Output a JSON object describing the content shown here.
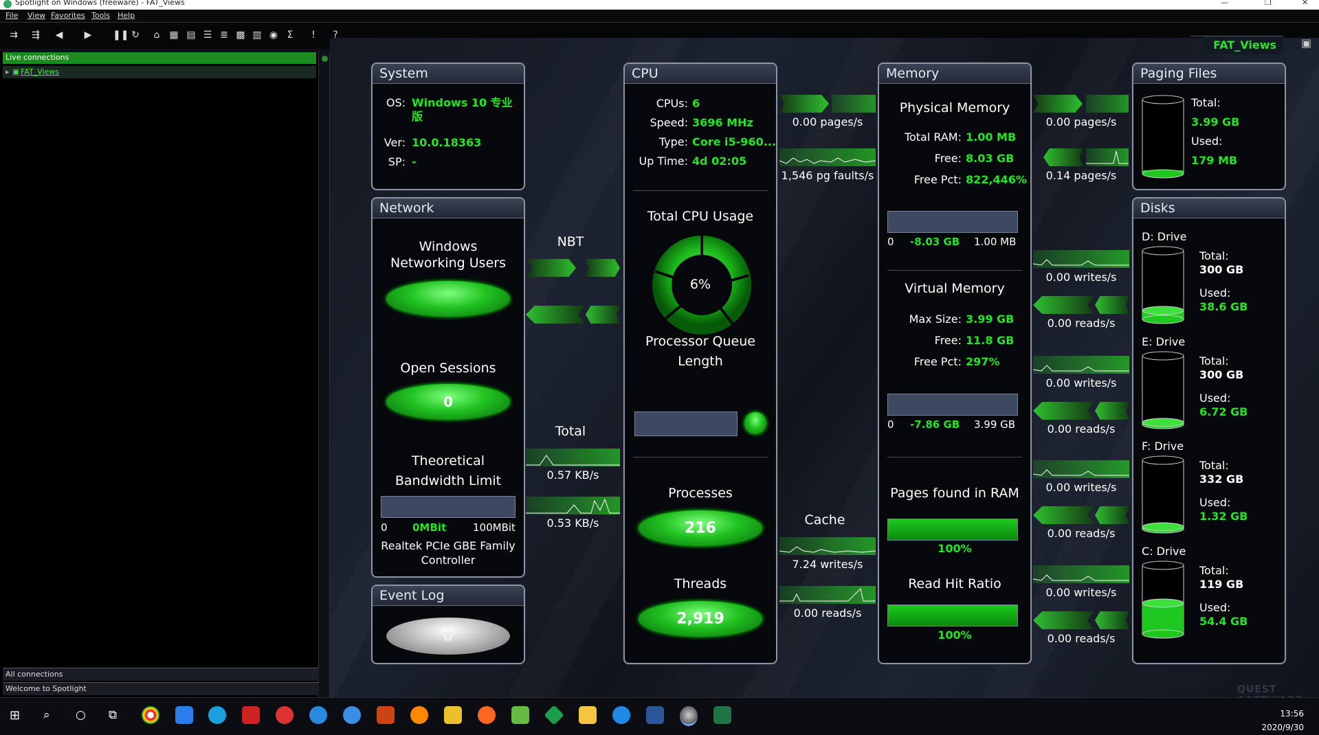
{
  "window": {
    "title": "Spotlight on Windows (freeware) - FAT_Views"
  },
  "menu": [
    "File",
    "View",
    "Favorites",
    "Tools",
    "Help"
  ],
  "toolbar_icons": [
    "connect-icon",
    "disconnect-icon",
    "back-icon",
    "forward-icon",
    "pause-icon",
    "refresh-icon",
    "home-icon",
    "grid-icon",
    "table-icon",
    "list-icon",
    "stack-icon",
    "tiles-icon",
    "chart-icon",
    "disk-icon",
    "sum-icon",
    "alert-icon",
    "help-icon"
  ],
  "left": {
    "live_connections": "Live connections",
    "tree_item": "FAT_Views",
    "all_connections": "All connections",
    "welcome": "Welcome to Spotlight"
  },
  "view_tab": "FAT_Views",
  "system": {
    "title": "System",
    "os_label": "OS:",
    "os_value": "Windows 10 专业版",
    "ver_label": "Ver:",
    "ver_value": "10.0.18363",
    "sp_label": "SP:",
    "sp_value": "-"
  },
  "network": {
    "title": "Network",
    "win_users": "Windows Networking Users",
    "open_sessions": "Open Sessions",
    "open_sessions_value": "0",
    "bandwidth_title": "Theoretical Bandwidth Limit",
    "bw_min": "0",
    "bw_value": "0MBit",
    "bw_max": "100MBit",
    "adapter": "Realtek PCIe GBE Family Controller"
  },
  "nbt": {
    "label": "NBT"
  },
  "total": {
    "label": "Total",
    "in": "0.57 KB/s",
    "out": "0.53 KB/s"
  },
  "event_log": {
    "title": "Event Log",
    "value": "0"
  },
  "cpu": {
    "title": "CPU",
    "cpus_label": "CPUs:",
    "cpus": "6",
    "speed_label": "Speed:",
    "speed": "3696 MHz",
    "type_label": "Type:",
    "type": "Core i5-960...",
    "uptime_label": "Up Time:",
    "uptime": "4d 02:05",
    "total_usage_label": "Total CPU Usage",
    "total_usage": "6%",
    "queue_label": "Processor Queue Length",
    "processes_label": "Processes",
    "processes": "216",
    "threads_label": "Threads",
    "threads": "2,919"
  },
  "cpu_mem_flow": {
    "pages": "0.00 pages/s",
    "faults": "1,546 pg faults/s"
  },
  "cache": {
    "label": "Cache",
    "writes": "7.24 writes/s",
    "reads": "0.00 reads/s"
  },
  "memory": {
    "title": "Memory",
    "physical": "Physical Memory",
    "total_ram_label": "Total RAM:",
    "total_ram": "1.00 MB",
    "free_label": "Free:",
    "free": "8.03 GB",
    "free_pct_label": "Free Pct:",
    "free_pct": "822,446%",
    "pbar_min": "0",
    "pbar_val": "-8.03 GB",
    "pbar_max": "1.00 MB",
    "virtual": "Virtual Memory",
    "max_size_label": "Max Size:",
    "max_size": "3.99 GB",
    "vfree_label": "Free:",
    "vfree": "11.8 GB",
    "vfree_pct_label": "Free Pct:",
    "vfree_pct": "297%",
    "vbar_min": "0",
    "vbar_val": "-7.86 GB",
    "vbar_max": "3.99 GB",
    "pages_found_label": "Pages found in RAM",
    "pages_found": "100%",
    "pages_found_fraction": 1.0,
    "read_hit_label": "Read Hit Ratio",
    "read_hit": "100%",
    "read_hit_fraction": 1.0
  },
  "mem_paging_flow": {
    "pages_top": "0.00 pages/s",
    "pages_bottom": "0.14 pages/s"
  },
  "paging": {
    "title": "Paging Files",
    "total_label": "Total:",
    "total": "3.99 GB",
    "used_label": "Used:",
    "used": "179 MB",
    "used_fraction": 0.045
  },
  "disk_flows": [
    {
      "writes": "0.00 writes/s",
      "reads": "0.00 reads/s"
    },
    {
      "writes": "0.00 writes/s",
      "reads": "0.00 reads/s"
    },
    {
      "writes": "0.00 writes/s",
      "reads": "0.00 reads/s"
    },
    {
      "writes": "0.00 writes/s",
      "reads": "0.00 reads/s"
    }
  ],
  "disks": {
    "title": "Disks",
    "items": [
      {
        "name": "D: Drive",
        "total_label": "Total:",
        "total": "300 GB",
        "used_label": "Used:",
        "used": "38.6 GB",
        "used_fraction": 0.13
      },
      {
        "name": "E: Drive",
        "total_label": "Total:",
        "total": "300 GB",
        "used_label": "Used:",
        "used": "6.72 GB",
        "used_fraction": 0.02
      },
      {
        "name": "F: Drive",
        "total_label": "Total:",
        "total": "332 GB",
        "used_label": "Used:",
        "used": "1.32 GB",
        "used_fraction": 0.01
      },
      {
        "name": "C: Drive",
        "total_label": "Total:",
        "total": "119 GB",
        "used_label": "Used:",
        "used": "54.4 GB",
        "used_fraction": 0.46
      }
    ]
  },
  "brand": "QUEST SOFTWARE",
  "taskbar": {
    "time": "13:56",
    "date": "2020/9/30"
  },
  "colors": {
    "accent_green": "#22e622",
    "panel_border": "#8d94a6",
    "background": "#1c2230"
  }
}
